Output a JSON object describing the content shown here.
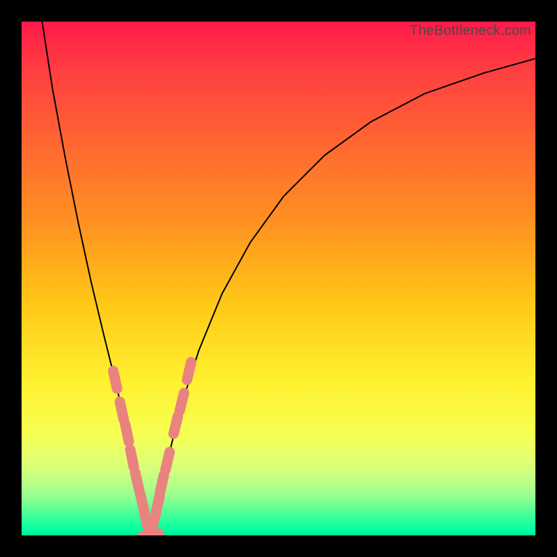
{
  "watermark": "TheBottleneck.com",
  "chart_data": {
    "type": "line",
    "title": "",
    "xlabel": "",
    "ylabel": "",
    "xlim": [
      0,
      1
    ],
    "ylim": [
      0,
      1
    ],
    "axes_visible": false,
    "grid": false,
    "background": "vertical-gradient",
    "background_colors_top_to_bottom": [
      "#ff1a4b",
      "#ff6a30",
      "#ffc817",
      "#fff12f",
      "#ccff80",
      "#5aff96",
      "#00ffa2"
    ],
    "series": [
      {
        "name": "curve-left",
        "stroke": "#000000",
        "x": [
          0.04,
          0.06,
          0.085,
          0.11,
          0.135,
          0.16,
          0.185,
          0.205,
          0.223,
          0.235,
          0.244,
          0.25
        ],
        "y": [
          1.0,
          0.87,
          0.735,
          0.61,
          0.495,
          0.39,
          0.29,
          0.2,
          0.115,
          0.06,
          0.02,
          0.0
        ]
      },
      {
        "name": "curve-right",
        "stroke": "#000000",
        "x": [
          0.25,
          0.265,
          0.285,
          0.31,
          0.345,
          0.39,
          0.445,
          0.51,
          0.59,
          0.68,
          0.785,
          0.9,
          1.0
        ],
        "y": [
          0.0,
          0.06,
          0.15,
          0.25,
          0.36,
          0.47,
          0.57,
          0.66,
          0.74,
          0.805,
          0.86,
          0.9,
          0.928
        ]
      },
      {
        "name": "sample-points",
        "type": "scatter",
        "marker": "pill",
        "color": "#e98380",
        "x": [
          0.182,
          0.195,
          0.205,
          0.215,
          0.225,
          0.235,
          0.243,
          0.25,
          0.258,
          0.265,
          0.273,
          0.284,
          0.3,
          0.312,
          0.326
        ],
        "y": [
          0.303,
          0.243,
          0.2,
          0.15,
          0.105,
          0.063,
          0.027,
          0.0,
          0.03,
          0.06,
          0.1,
          0.145,
          0.215,
          0.26,
          0.32
        ]
      }
    ],
    "notes": "Axes and gridlines are intentionally absent; values are normalized 0..1 estimates read from the image. The black V-curve reaches its minimum near x≈0.25 at the bottom edge; salmon capsule markers lie along both branches near the minimum."
  },
  "colors": {
    "marker": "#e98380",
    "curve": "#000000",
    "frame": "#000000"
  }
}
